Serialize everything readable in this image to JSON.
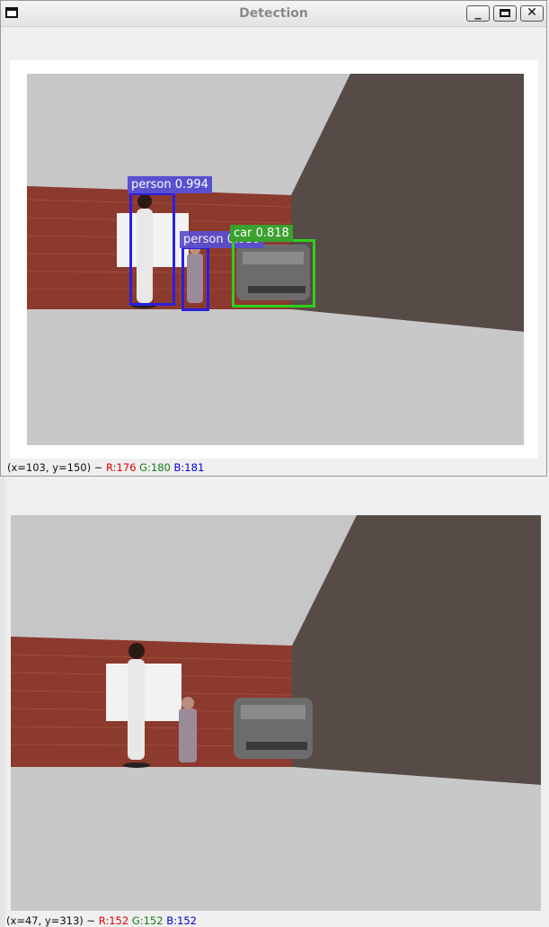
{
  "window": {
    "title": "Detection",
    "minimize_glyph": "_",
    "close_glyph": "✕"
  },
  "detections": [
    {
      "label": "person 0.994",
      "class": "person",
      "score": 0.994,
      "color": "#2a1fe0"
    },
    {
      "label": "person 0.939",
      "class": "person",
      "score": 0.939,
      "color": "#2a1fe0"
    },
    {
      "label": "car 0.818",
      "class": "car",
      "score": 0.818,
      "color": "#2bd01b"
    }
  ],
  "status_top": {
    "coords": "(x=103, y=150) ~",
    "r": "R:176",
    "g": "G:180",
    "b": "B:181"
  },
  "status_bottom": {
    "coords": "(x=47, y=313) ~",
    "r": "R:152",
    "g": "G:152",
    "b": "B:152"
  },
  "colors": {
    "wall_brick": "#8c3a2e",
    "wall_dark": "#574b47",
    "floor": "#c9c9c9",
    "sky": "#bdbdbd",
    "person_box": "#2a1fe0",
    "car_box": "#2bd01b"
  }
}
